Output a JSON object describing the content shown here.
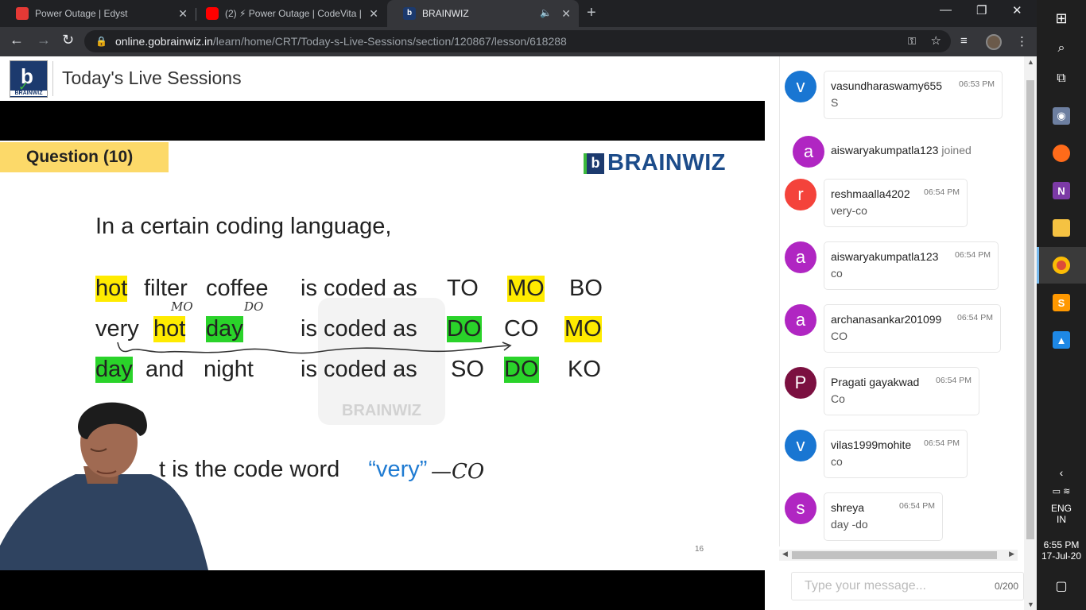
{
  "browser": {
    "tabs": [
      {
        "title": "Power Outage | Edyst",
        "color": "#e53935"
      },
      {
        "title": "(2) ⚡ Power Outage | CodeVita |",
        "color": "#ff0000"
      },
      {
        "title": "BRAINWIZ",
        "color": "#1c3a6e"
      }
    ],
    "url_host": "online.gobrainwiz.in",
    "url_path": "/learn/home/CRT/Today-s-Live-Sessions/section/120867/lesson/618288"
  },
  "header": {
    "logo_text": "BRAINWIZ",
    "title": "Today's Live Sessions"
  },
  "slide": {
    "question_label": "Question (10)",
    "brand": "BRAINWIZ",
    "brand_mark": "b",
    "watermark": "BRAINWIZ",
    "intro": "In a certain coding language,",
    "lines": [
      [
        "hot",
        "filter",
        "coffee",
        "is coded as",
        "TO",
        "MO",
        "BO"
      ],
      [
        "very",
        "hot",
        "day",
        "is coded as",
        "DO",
        "CO",
        "MO"
      ],
      [
        "day",
        "and",
        "night",
        "is coded as",
        "SO",
        "DO",
        "KO"
      ]
    ],
    "annotations": {
      "hot": "MO",
      "day": "DO"
    },
    "ask_prefix": "t is the code word",
    "ask_quote": "“very”",
    "answer": "—CO",
    "page_number": "16"
  },
  "chat": {
    "messages": [
      {
        "user": "vasundharaswamy655",
        "time": "06:53 PM",
        "text": "S",
        "initial": "v",
        "color": "#1976d2"
      },
      {
        "user": "reshmaalla4202",
        "time": "06:54 PM",
        "text": "very-co",
        "initial": "r",
        "color": "#f4433b"
      },
      {
        "user": "aiswaryakumpatla123",
        "time": "06:54 PM",
        "text": "co",
        "initial": "a",
        "color": "#b026c2"
      },
      {
        "user": "archanasankar201099",
        "time": "06:54 PM",
        "text": "CO",
        "initial": "a",
        "color": "#b026c2"
      },
      {
        "user": "Pragati gayakwad",
        "time": "06:54 PM",
        "text": "Co",
        "initial": "P",
        "color": "#7b1040"
      },
      {
        "user": "vilas1999mohite",
        "time": "06:54 PM",
        "text": "co",
        "initial": "v",
        "color": "#1976d2"
      },
      {
        "user": "shreya",
        "time": "06:54 PM",
        "text": "day -do",
        "initial": "s",
        "color": "#b026c2"
      }
    ],
    "join_event": {
      "user": "aiswaryakumpatla123",
      "action": "joined",
      "initial": "a",
      "color": "#b026c2"
    },
    "input_placeholder": "Type your message...",
    "char_counter": "0/200"
  },
  "taskbar": {
    "language": "ENG",
    "region": "IN",
    "time": "6:55 PM",
    "date": "17-Jul-20"
  }
}
